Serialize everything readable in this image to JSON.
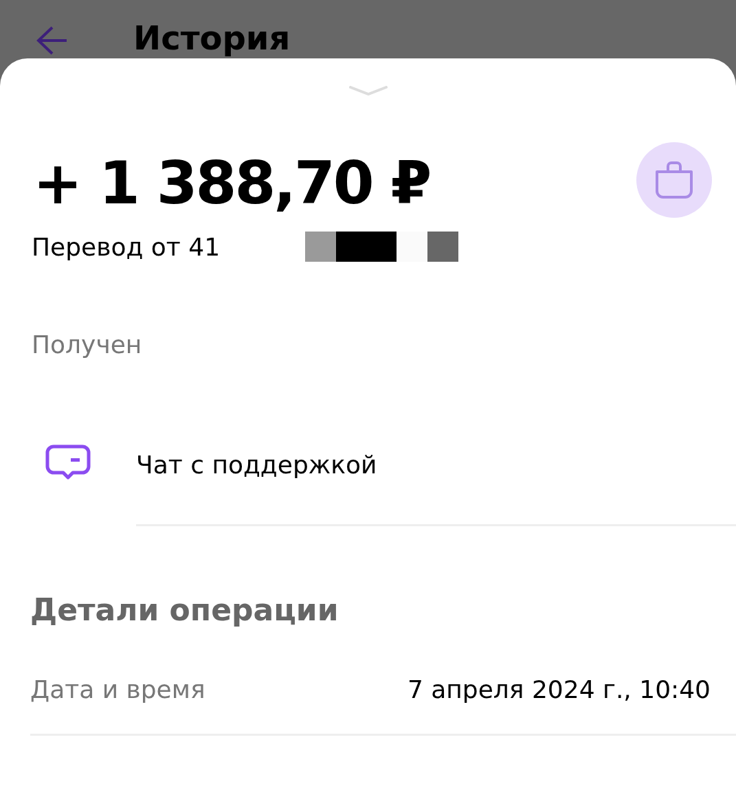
{
  "header": {
    "title": "История"
  },
  "amount": "+ 1 388,70 ₽",
  "subtitle": "Перевод от 41",
  "status": "Получен",
  "support": {
    "label": "Чат с поддержкой"
  },
  "details": {
    "title": "Детали операции",
    "rows": [
      {
        "label": "Дата и время",
        "value": "7 апреля 2024 г., 10:40"
      }
    ]
  }
}
